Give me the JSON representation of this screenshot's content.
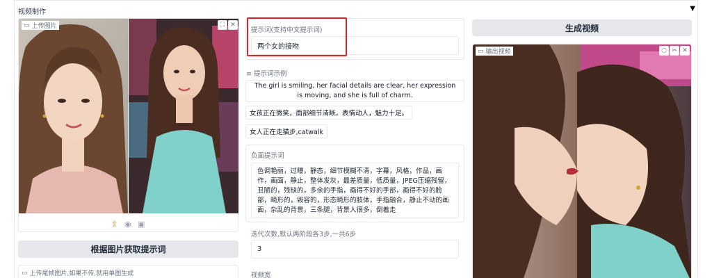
{
  "panel": {
    "title": "视频制作",
    "toggle": "▼"
  },
  "left": {
    "upload_label": "上传图片",
    "get_prompt_button": "根据图片获取提示词",
    "tail_upload_label": "上传尾帧图片,如果不传,就用单图生成",
    "icons": [
      "upload-icon",
      "webcam-icon",
      "clipboard-icon"
    ]
  },
  "middle": {
    "prompt_label": "提示词(支持中文提示词)",
    "prompt_value": "两个女的接吻",
    "examples_label": "提示词示例",
    "examples": [
      "The girl is smiling, her facial details are clear, her expression is moving, and she is full of charm.",
      "女孩正在微笑，面部细节清晰，表情动人，魅力十足。",
      "女人正在走猫步,catwalk"
    ],
    "negative_label": "负面提示词",
    "negative_value": "色调艳丽，过曝，静态，细节模糊不清，字幕，风格，作品，画作，画面，静止，整体发灰，最差质量，低质量，JPEG压缩残留，丑陋的，残缺的，多余的手指，画得不好的手部，画得不好的脸部，畸形的，毁容的，形态畸形的肢体，手指融合，静止不动的画面，杂乱的背景，三条腿，背景人很多，倒着走",
    "steps_label": "迭代次数,默认两阶段各3步,一共6步",
    "steps_value": "3",
    "width_label": "视频宽"
  },
  "right": {
    "generate_button": "生成视频",
    "output_label": "输出视频"
  },
  "colors": {
    "highlight": "#e02424",
    "button_bg": "#e5e7eb",
    "border": "#e5e7eb"
  }
}
